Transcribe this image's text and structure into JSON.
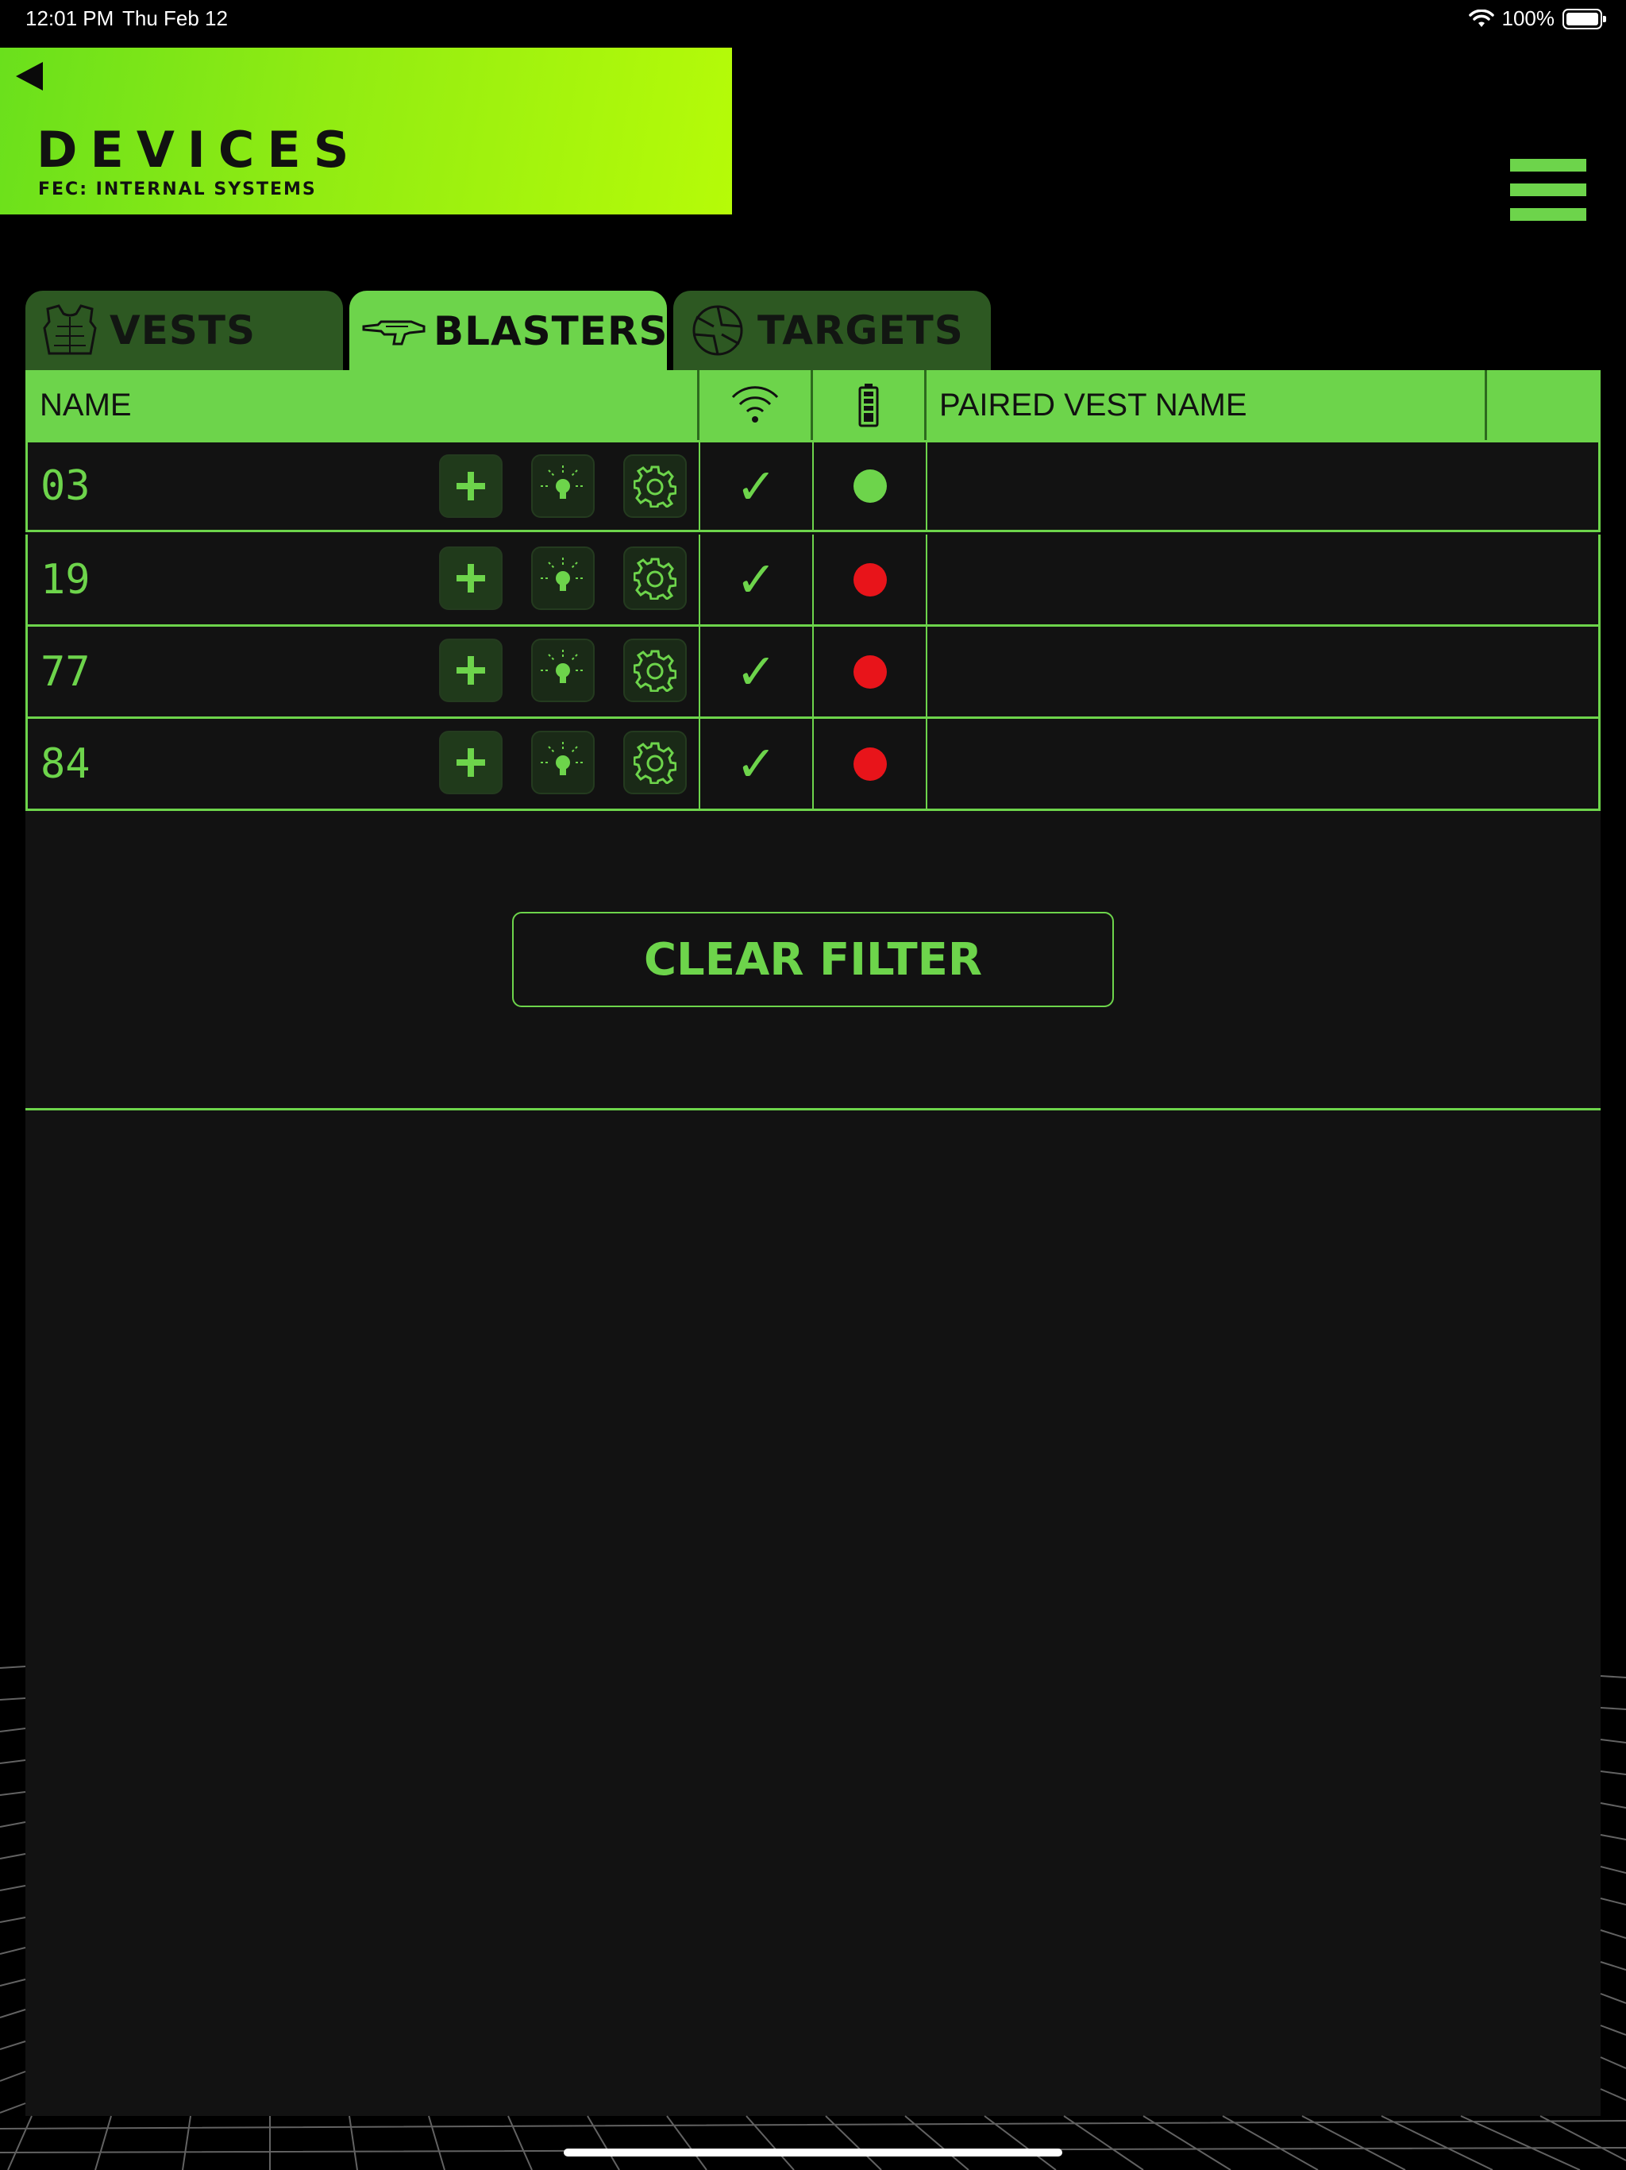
{
  "status_bar": {
    "time": "12:01 PM",
    "date": "Thu Feb 12",
    "battery_percent": "100%",
    "icons": [
      "wifi-icon",
      "battery-icon"
    ]
  },
  "header": {
    "title": "DEVICES",
    "subtitle": "FEC: INTERNAL SYSTEMS",
    "back_icon": "back-triangle-icon",
    "menu_icon": "hamburger-menu-icon"
  },
  "tabs": [
    {
      "label": "VESTS",
      "icon": "vest-icon",
      "active": false
    },
    {
      "label": "BLASTERS",
      "icon": "blaster-icon",
      "active": true
    },
    {
      "label": "TARGETS",
      "icon": "target-icon",
      "active": false
    }
  ],
  "table": {
    "columns": {
      "name": "NAME",
      "wifi_icon": "wifi-icon",
      "battery_icon": "battery-icon",
      "paired_vest": "PAIRED VEST NAME"
    },
    "rows": [
      {
        "name": "03",
        "connected": "✓",
        "battery_status": "ok",
        "paired_vest": ""
      },
      {
        "name": "19",
        "connected": "✓",
        "battery_status": "low",
        "paired_vest": ""
      },
      {
        "name": "77",
        "connected": "✓",
        "battery_status": "low",
        "paired_vest": ""
      },
      {
        "name": "84",
        "connected": "✓",
        "battery_status": "low",
        "paired_vest": ""
      }
    ],
    "row_actions": [
      "add-icon",
      "light-bulb-icon",
      "gear-icon"
    ]
  },
  "clear_filter_label": "CLEAR FILTER",
  "colors": {
    "accent": "#6dd44b",
    "header_gradient_start": "#6ae01c",
    "header_gradient_end": "#b6fb08",
    "status_ok": "#6dd44b",
    "status_low": "#e8141a",
    "panel_background": "#121212"
  }
}
